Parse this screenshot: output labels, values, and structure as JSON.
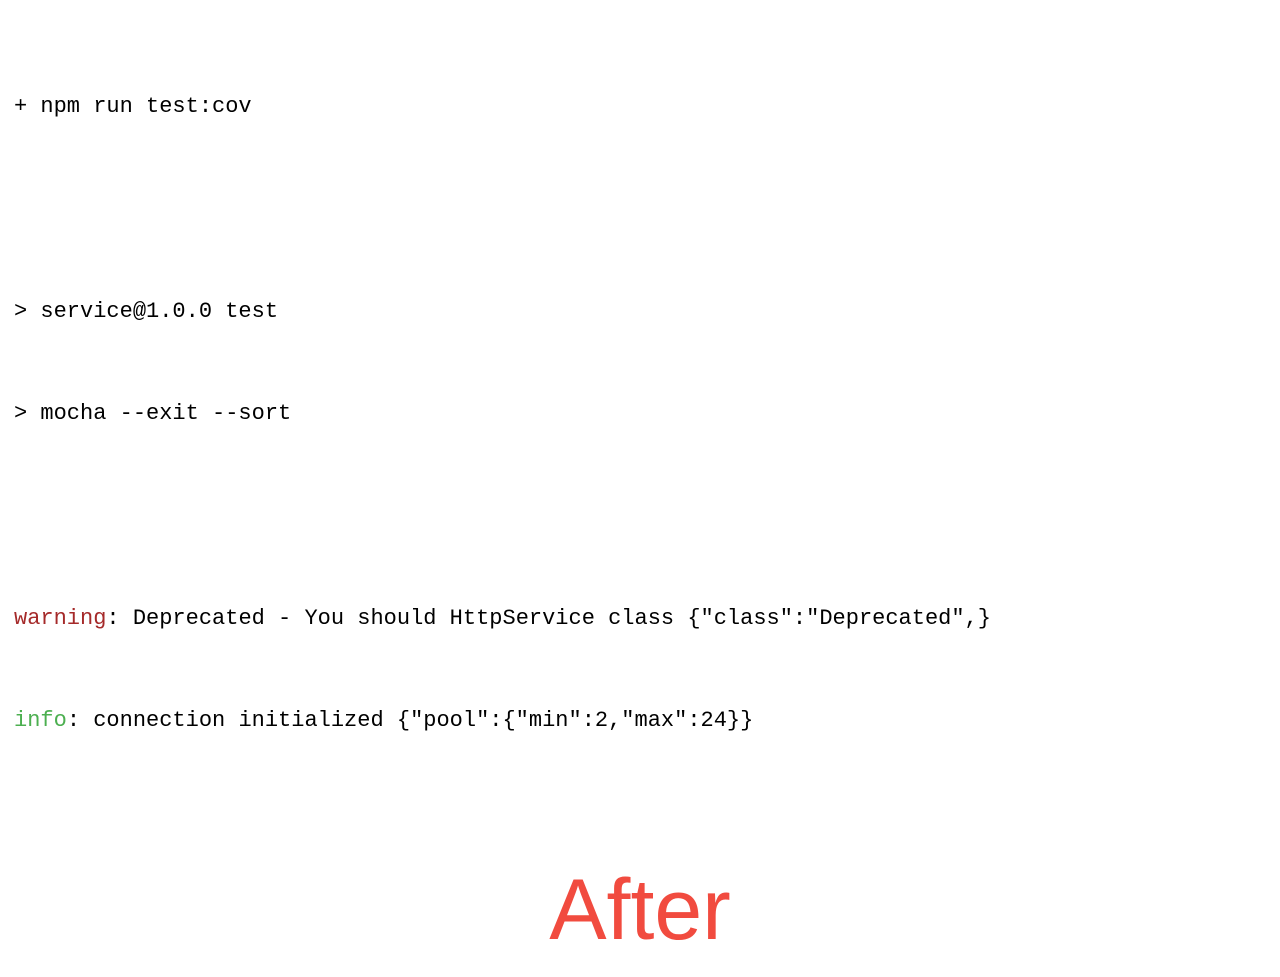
{
  "terminal": {
    "lines": [
      {
        "type": "cmd",
        "text": "+ npm run test:cov"
      },
      {
        "type": "blank"
      },
      {
        "type": "out",
        "text": "> service@1.0.0 test"
      },
      {
        "type": "out",
        "text": "> mocha --exit --sort"
      },
      {
        "type": "blank"
      },
      {
        "type": "log",
        "level": "warning",
        "level_color": "#a52a2a",
        "text": ": Deprecated - You should HttpService class {\"class\":\"Deprecated\",}"
      },
      {
        "type": "log",
        "level": "info",
        "level_color": "#4caf50",
        "text": ": connection initialized {\"pool\":{\"min\":2,\"max\":24}}"
      }
    ]
  },
  "label": {
    "after": "After",
    "color": "#f14b3f"
  }
}
